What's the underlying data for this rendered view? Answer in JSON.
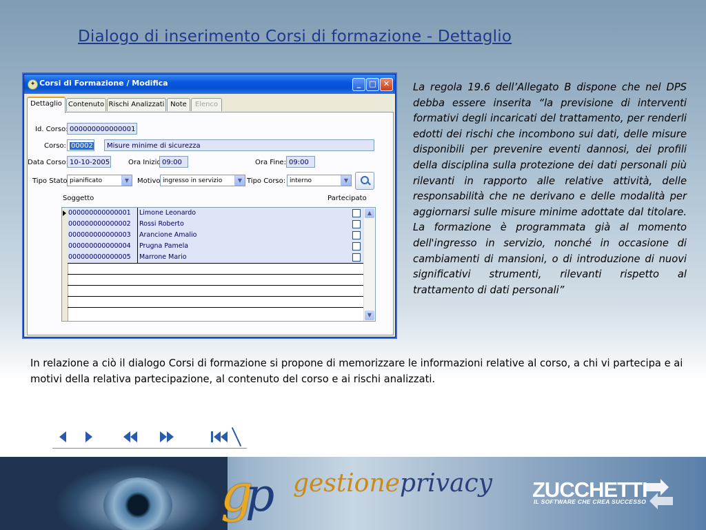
{
  "slide": {
    "title": "Dialogo di inserimento Corsi di formazione - Dettaglio",
    "side_text": "La regola 19.6 dell’Allegato B dispone che nel DPS debba essere inserita “la previsione di interventi formativi degli incaricati del trattamento, per renderli edotti dei rischi che incombono sui dati, delle misure disponibili per prevenire eventi dannosi, dei profili della disciplina sulla protezione dei dati personali più rilevanti in rapporto alle relative attività, delle responsabilità che ne derivano e delle modalità per aggiornarsi sulle misure minime adottate dal titolare. La formazione è programmata già al momento dell'ingresso in servizio, nonché in occasione di cambiamenti di mansioni, o di introduzione di nuovi significativi strumenti, rilevanti rispetto al trattamento di dati personali”",
    "body_text": "In relazione a ciò il dialogo Corsi di formazione si propone di memorizzare le informazioni relative al corso, a chi vi partecipa e ai motivi della relativa partecipazione, al contenuto del corso e ai rischi analizzati."
  },
  "window": {
    "title": "Corsi di Formazione / Modifica",
    "tabs": [
      {
        "label": "Dettaglio"
      },
      {
        "label": "Contenuto"
      },
      {
        "label": "Rischi Analizzati"
      },
      {
        "label": "Note"
      },
      {
        "label": "Elenco"
      }
    ]
  },
  "form": {
    "id_corso_label": "Id. Corso:",
    "id_corso_value": "000000000000001",
    "corso_label": "Corso:",
    "corso_code": "00002",
    "corso_desc": "Misure minime di sicurezza",
    "data_corso_label": "Data Corso:",
    "data_corso_value": "10-10-2005",
    "ora_inizio_label": "Ora Inizio:",
    "ora_inizio_value": "09:00",
    "ora_fine_label": "Ora Fine:",
    "ora_fine_value": "09:00",
    "tipo_stato_label": "Tipo Stato:",
    "tipo_stato_value": "pianificato",
    "motivo_label": "Motivo:",
    "motivo_value": "ingresso in servizio",
    "tipo_corso_label": "Tipo Corso:",
    "tipo_corso_value": "interno"
  },
  "grid": {
    "col_soggetto": "Soggetto",
    "col_partecipato": "Partecipato",
    "rows": [
      {
        "id": "000000000000001",
        "name": "Limone Leonardo"
      },
      {
        "id": "000000000000002",
        "name": "Rossi Roberto"
      },
      {
        "id": "000000000000003",
        "name": "Arancione Amalio"
      },
      {
        "id": "000000000000004",
        "name": "Prugna Pamela"
      },
      {
        "id": "000000000000005",
        "name": "Marrone Mario"
      }
    ]
  },
  "footer": {
    "brand_a": "gestione",
    "brand_b": "privacy",
    "gp_g": "g",
    "gp_p": "p",
    "company": "ZUCCHETTI",
    "company_tagline": "IL SOFTWARE CHE CREA SUCCESSO"
  }
}
